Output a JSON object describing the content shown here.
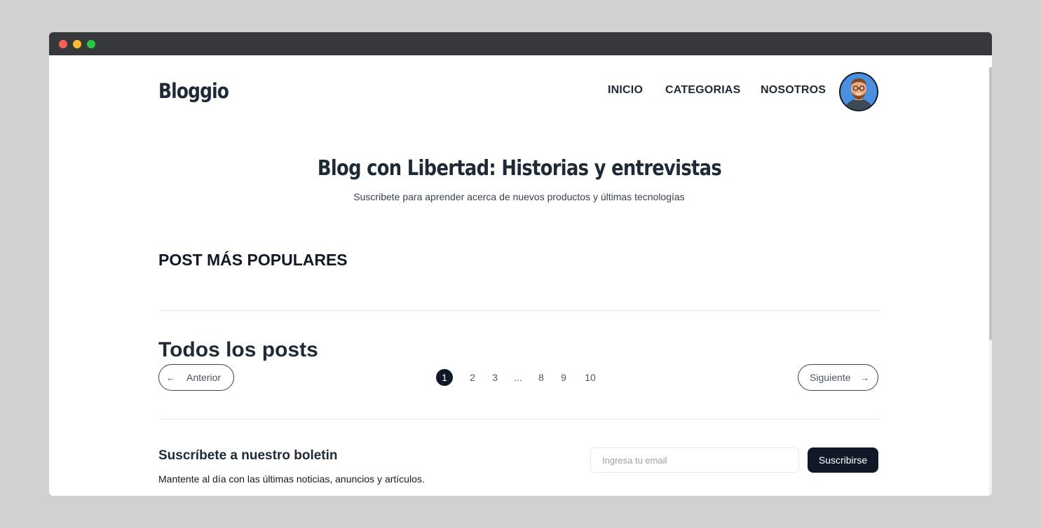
{
  "browser": {
    "window_controls": [
      "close",
      "minimize",
      "maximize"
    ]
  },
  "header": {
    "logo": "Bloggio",
    "nav": [
      "INICIO",
      "CATEGORIAS",
      "NOSOTROS"
    ],
    "avatar_icon": "user-avatar-icon"
  },
  "hero": {
    "title": "Blog con Libertad: Historias y entrevistas",
    "subtitle": "Suscribete para aprender acerca de nuevos productos y últimas tecnologías"
  },
  "popular": {
    "title": "POST MÁS POPULARES"
  },
  "posts": {
    "title": "Todos los posts",
    "prev_label": "Anterior",
    "next_label": "Siguiente",
    "prev_icon": "arrow-left-icon",
    "next_icon": "arrow-right-icon",
    "pages": [
      "1",
      "2",
      "3",
      "...",
      "8",
      "9",
      "10"
    ],
    "current_page": "1"
  },
  "newsletter": {
    "title": "Suscríbete a nuestro boletin",
    "subtitle": "Mantente al día con las últimas noticias, anuncios y artículos.",
    "email_placeholder": "Ingresa tu email",
    "email_value": "",
    "button_label": "Suscribirse"
  },
  "colors": {
    "background": "#d1d1d1",
    "titlebar": "#36383b",
    "primary_dark": "#111827",
    "text": "#1f2a37",
    "muted": "#4b5563"
  }
}
